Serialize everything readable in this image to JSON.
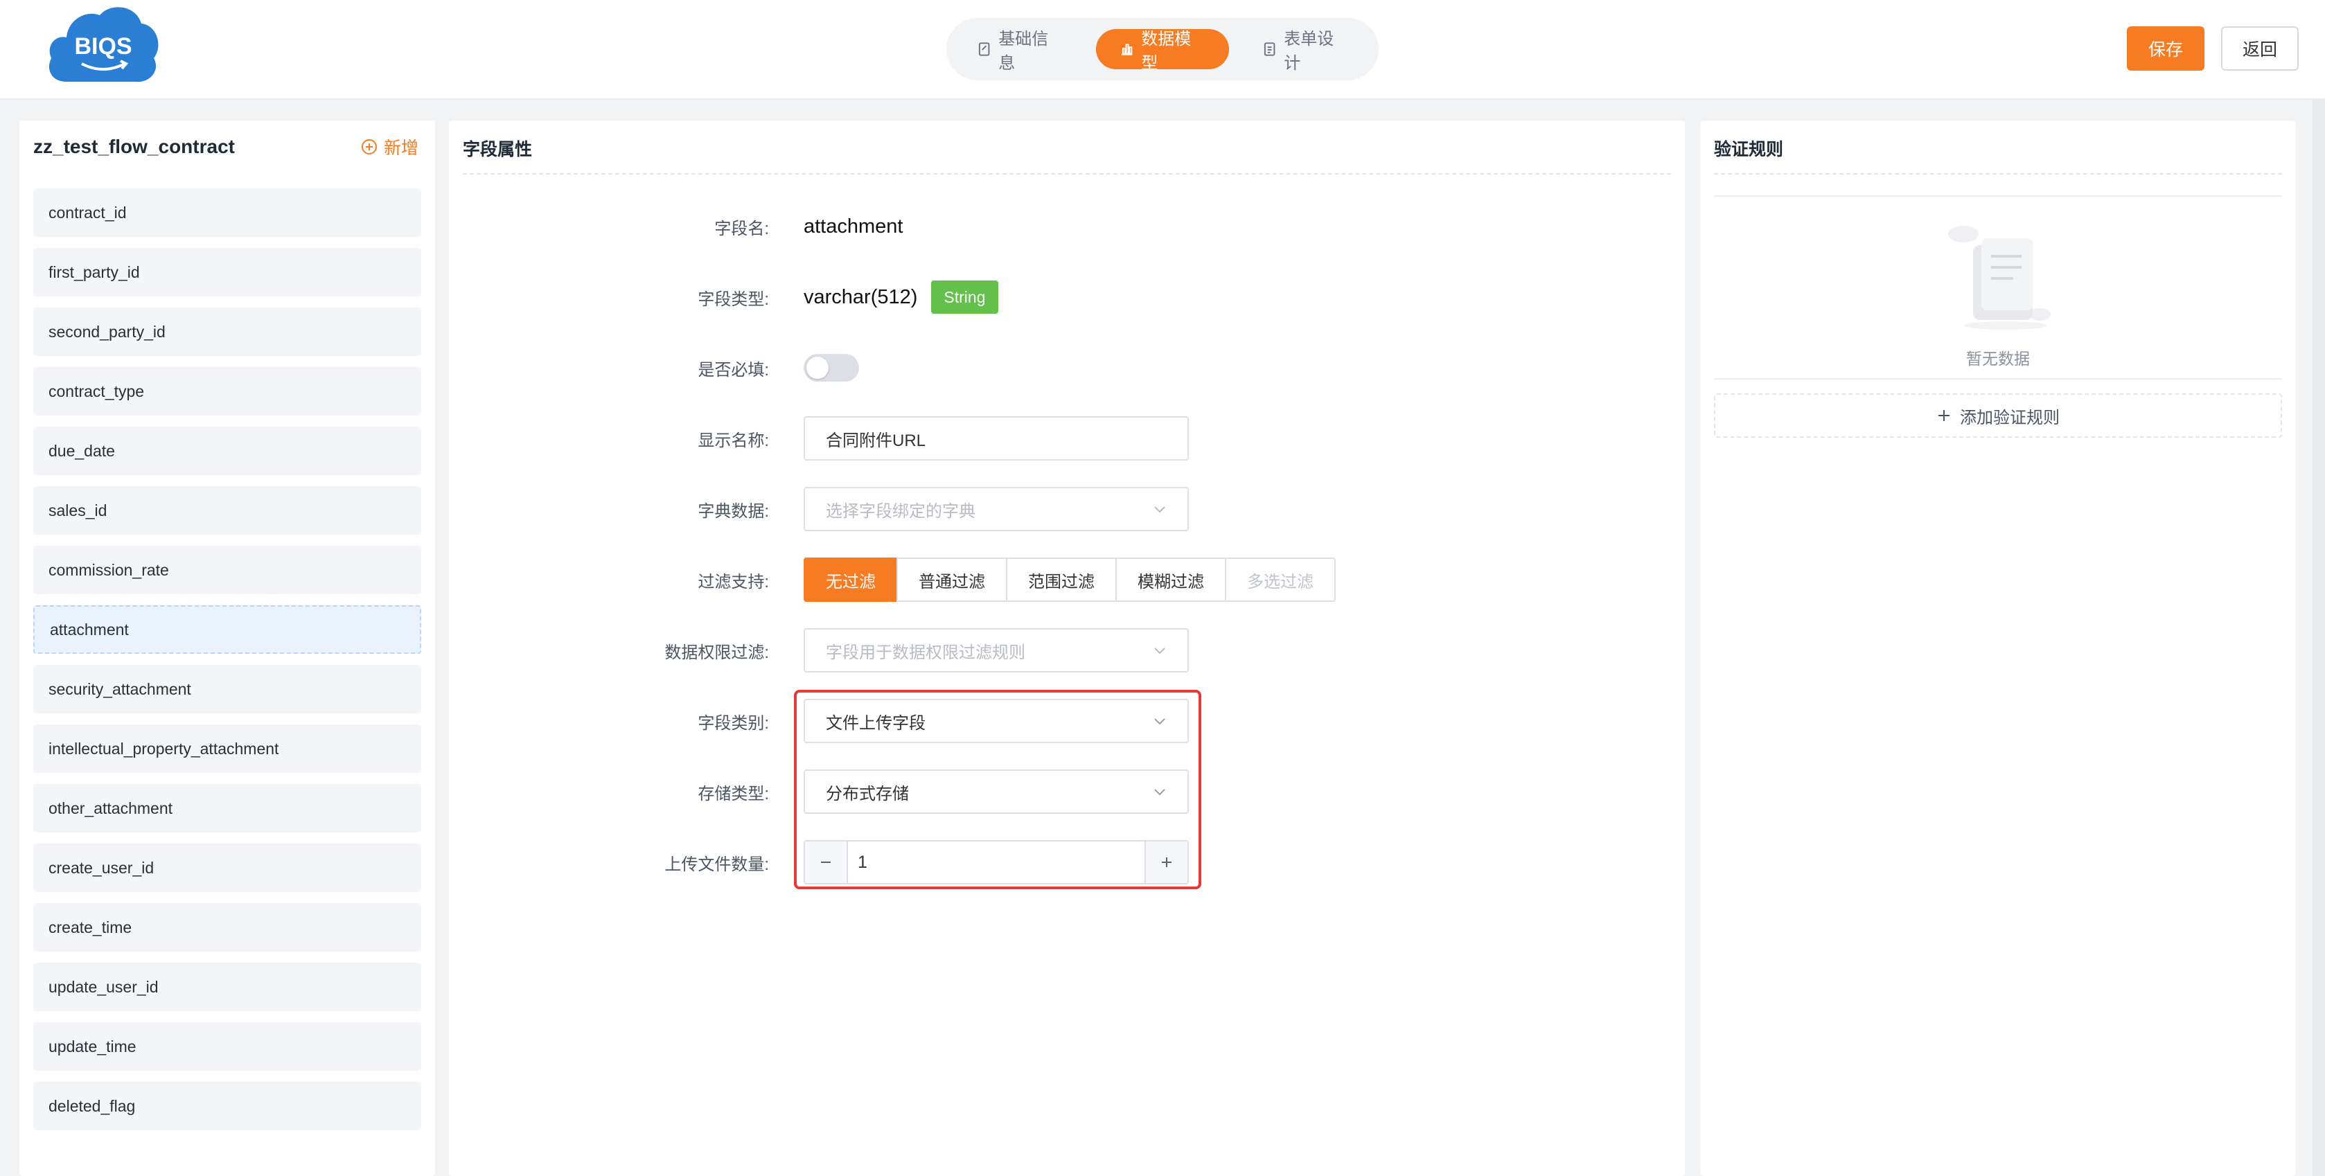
{
  "header": {
    "logo_text": "BIQS",
    "tabs": [
      {
        "label": "基础信息",
        "icon": "edit-doc-icon",
        "active": false
      },
      {
        "label": "数据模型",
        "icon": "bar-chart-icon",
        "active": true
      },
      {
        "label": "表单设计",
        "icon": "form-doc-icon",
        "active": false
      }
    ],
    "save_label": "保存",
    "back_label": "返回"
  },
  "left_panel": {
    "title": "zz_test_flow_contract",
    "add_label": "新增",
    "fields": [
      "contract_id",
      "first_party_id",
      "second_party_id",
      "contract_type",
      "due_date",
      "sales_id",
      "commission_rate",
      "attachment",
      "security_attachment",
      "intellectual_property_attachment",
      "other_attachment",
      "create_user_id",
      "create_time",
      "update_user_id",
      "update_time",
      "deleted_flag"
    ],
    "selected_field": "attachment"
  },
  "middle_panel": {
    "title": "字段属性",
    "field_name_label": "字段名:",
    "field_name": "attachment",
    "field_type_label": "字段类型:",
    "field_type": "varchar(512)",
    "field_type_tag": "String",
    "required_label": "是否必填:",
    "required": false,
    "display_name_label": "显示名称:",
    "display_name": "合同附件URL",
    "dict_label": "字典数据:",
    "dict_placeholder": "选择字段绑定的字典",
    "filter_label": "过滤支持:",
    "filter_options": [
      "无过滤",
      "普通过滤",
      "范围过滤",
      "模糊过滤",
      "多选过滤"
    ],
    "filter_selected": "无过滤",
    "perm_filter_label": "数据权限过滤:",
    "perm_filter_placeholder": "字段用于数据权限过滤规则",
    "category_label": "字段类别:",
    "category_value": "文件上传字段",
    "storage_label": "存储类型:",
    "storage_value": "分布式存储",
    "upload_count_label": "上传文件数量:",
    "upload_count": "1"
  },
  "right_panel": {
    "title": "验证规则",
    "empty_text": "暂无数据",
    "add_rule_label": "添加验证规则"
  },
  "colors": {
    "accent": "#f77b22",
    "tag_green": "#62c04b",
    "highlight_red": "#e53935",
    "logo_blue": "#2a7fd4"
  }
}
